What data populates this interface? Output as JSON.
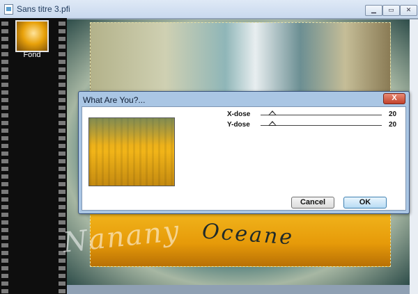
{
  "window": {
    "title": "Sans titre 3.pfi",
    "controls": {
      "minimize_icon": "minimize-icon",
      "maximize_icon": "maximize-icon",
      "close_icon": "close-icon"
    }
  },
  "layers": [
    {
      "label": "Fond"
    }
  ],
  "canvas": {
    "watermark_text": "Nanany",
    "caption_text": "Oceane"
  },
  "dialog": {
    "title": "What Are You?...",
    "close_label": "X",
    "params": [
      {
        "label": "X-dose",
        "value": "20",
        "fraction": 0.1
      },
      {
        "label": "Y-dose",
        "value": "20",
        "fraction": 0.1
      }
    ],
    "cancel_label": "Cancel",
    "ok_label": "OK"
  },
  "colors": {
    "dialog_frame": "#aac6e4",
    "close_button": "#c2422c",
    "ok_button": "#b8dcf4"
  }
}
